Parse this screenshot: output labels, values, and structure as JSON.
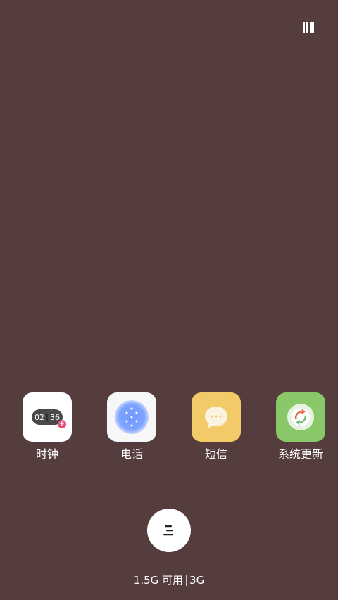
{
  "recents": {
    "apps": [
      {
        "label": "时钟",
        "icon": "clock-icon",
        "clock_hours": "02",
        "clock_minutes": "36",
        "badge": "+"
      },
      {
        "label": "电话",
        "icon": "phone-icon"
      },
      {
        "label": "短信",
        "icon": "messages-icon"
      },
      {
        "label": "系统更新",
        "icon": "system-update-icon"
      }
    ]
  },
  "memory": {
    "available": "1.5G 可用",
    "total": "3G"
  },
  "colors": {
    "background": "#553c3d",
    "clock_badge": "#e94d73",
    "phone_accent": "#8fb0ff",
    "messages_bg": "#f2cb68",
    "update_bg": "#8ac768",
    "update_accent": "#e06a4d"
  }
}
